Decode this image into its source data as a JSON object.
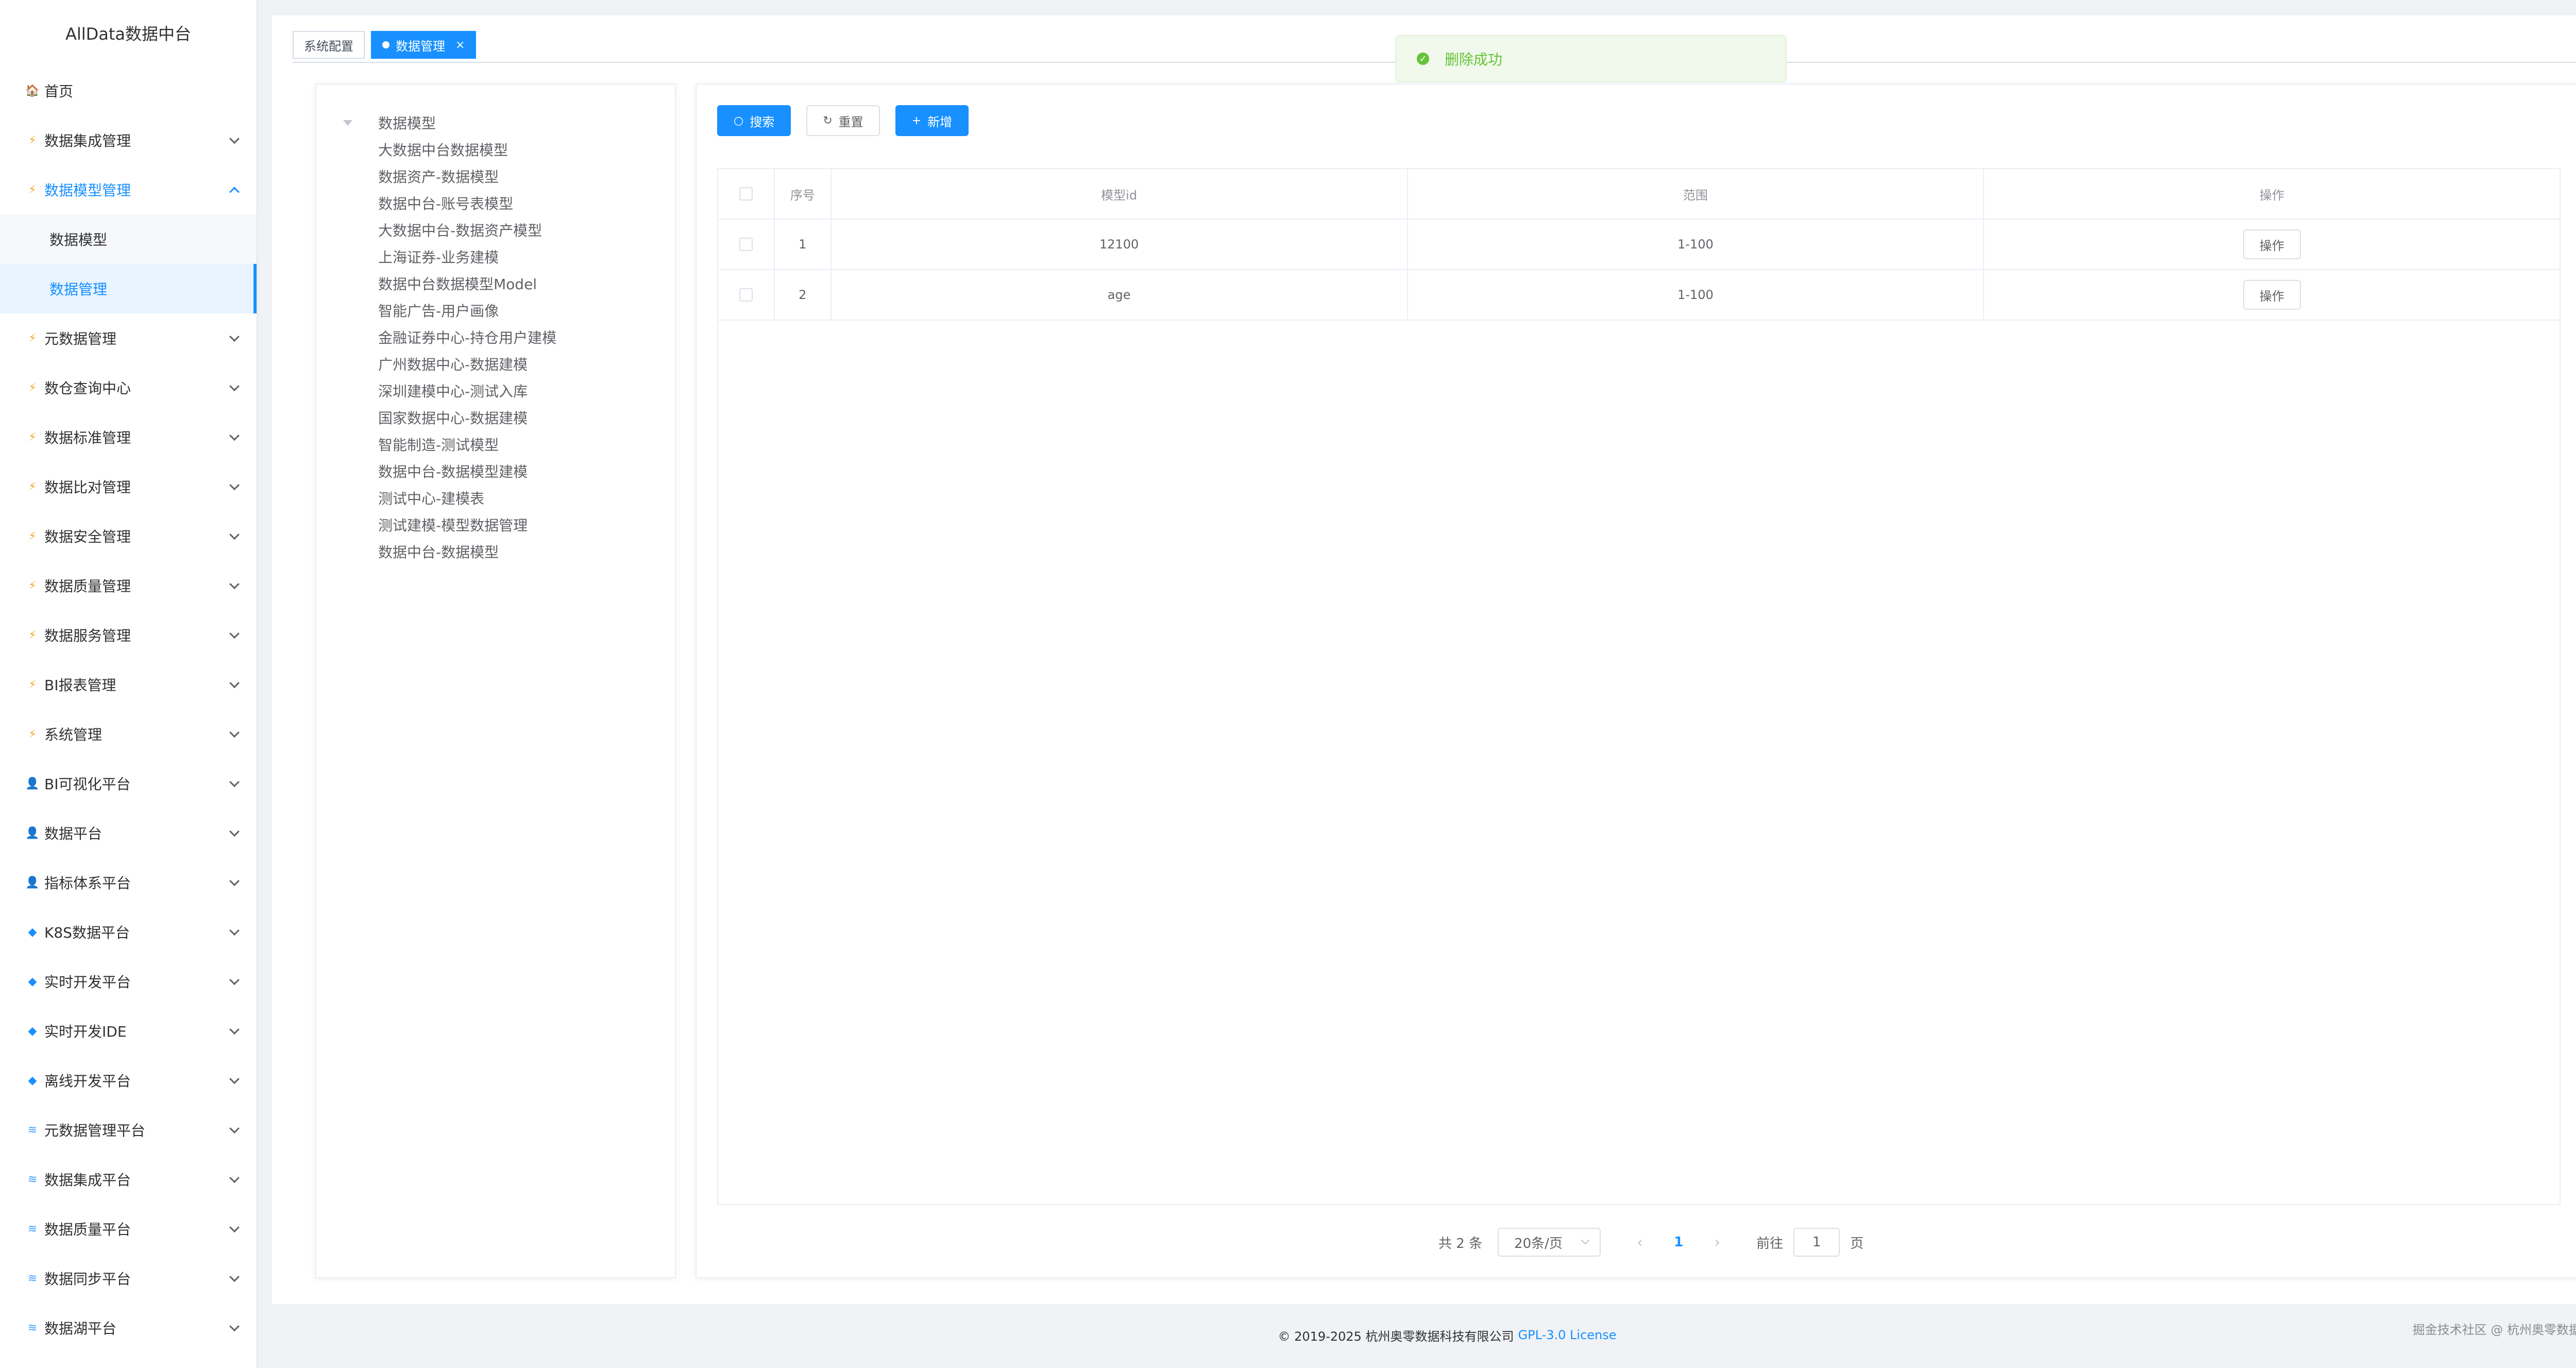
{
  "brand": "AllData数据中台",
  "sidebar": {
    "items": [
      {
        "icon": "🏠",
        "icon_name": "home-icon",
        "label": "首页"
      },
      {
        "icon": "⚡",
        "icon_name": "bolt-icon",
        "label": "数据集成管理"
      },
      {
        "icon": "⚡",
        "icon_name": "bolt-icon",
        "label": "数据模型管理"
      },
      {
        "icon": "⚡",
        "icon_name": "bolt-icon",
        "label": "元数据管理"
      },
      {
        "icon": "⚡",
        "icon_name": "bolt-icon",
        "label": "数仓查询中心"
      },
      {
        "icon": "⚡",
        "icon_name": "bolt-icon",
        "label": "数据标准管理"
      },
      {
        "icon": "⚡",
        "icon_name": "bolt-icon",
        "label": "数据比对管理"
      },
      {
        "icon": "⚡",
        "icon_name": "bolt-icon",
        "label": "数据安全管理"
      },
      {
        "icon": "⚡",
        "icon_name": "bolt-icon",
        "label": "数据质量管理"
      },
      {
        "icon": "⚡",
        "icon_name": "bolt-icon",
        "label": "数据服务管理"
      },
      {
        "icon": "⚡",
        "icon_name": "bolt-icon",
        "label": "BI报表管理"
      },
      {
        "icon": "⚡",
        "icon_name": "bolt-icon",
        "label": "系统管理"
      },
      {
        "icon": "👤",
        "icon_name": "person-icon",
        "label": "BI可视化平台"
      },
      {
        "icon": "👤",
        "icon_name": "person-icon",
        "label": "数据平台"
      },
      {
        "icon": "👤",
        "icon_name": "person-icon",
        "label": "指标体系平台"
      },
      {
        "icon": "◆",
        "icon_name": "gem-icon",
        "label": "K8S数据平台"
      },
      {
        "icon": "◆",
        "icon_name": "gem-icon",
        "label": "实时开发平台"
      },
      {
        "icon": "◆",
        "icon_name": "gem-icon",
        "label": "实时开发IDE"
      },
      {
        "icon": "◆",
        "icon_name": "gem-icon",
        "label": "离线开发平台"
      },
      {
        "icon": "≋",
        "icon_name": "stack-icon",
        "label": "元数据管理平台"
      },
      {
        "icon": "≋",
        "icon_name": "stack-icon",
        "label": "数据集成平台"
      },
      {
        "icon": "≋",
        "icon_name": "stack-icon",
        "label": "数据质量平台"
      },
      {
        "icon": "≋",
        "icon_name": "stack-icon",
        "label": "数据同步平台"
      },
      {
        "icon": "≋",
        "icon_name": "stack-icon",
        "label": "数据湖平台"
      }
    ],
    "sub_items": [
      {
        "label": "数据模型"
      },
      {
        "label": "数据管理"
      }
    ]
  },
  "tags": {
    "first": "系统配置",
    "active": "数据管理",
    "close_glyph": "×"
  },
  "toast": {
    "icon": "✓",
    "text": "删除成功"
  },
  "tree": {
    "root": "数据模型",
    "children": [
      "大数据中台数据模型",
      "数据资产-数据模型",
      "数据中台-账号表模型",
      "大数据中台-数据资产模型",
      "上海证券-业务建模",
      "数据中台数据模型Model",
      "智能广告-用户画像",
      "金融证券中心-持仓用户建模",
      "广州数据中心-数据建模",
      "深圳建模中心-测试入库",
      "国家数据中心-数据建模",
      "智能制造-测试模型",
      "数据中台-数据模型建模",
      "测试中心-建模表",
      "测试建模-模型数据管理",
      "数据中台-数据模型"
    ]
  },
  "toolbar": {
    "search_icon": "○",
    "search": "搜索",
    "reset_icon": "↻",
    "reset": "重置",
    "add_icon": "+",
    "add": "新增"
  },
  "table": {
    "headers": {
      "index": "序号",
      "model_id": "模型id",
      "range": "范围",
      "op": "操作"
    },
    "rows": [
      {
        "index": "1",
        "model_id": "12100",
        "range": "1-100",
        "op": "操作"
      },
      {
        "index": "2",
        "model_id": "age",
        "range": "1-100",
        "op": "操作"
      }
    ]
  },
  "pager": {
    "total": "共 2 条",
    "page_size": "20条/页",
    "prev": "‹",
    "current": "1",
    "next": "›",
    "goto_label": "前往",
    "goto_value": "1",
    "page_suffix": "页"
  },
  "footer": {
    "copyright": "© 2019-2025 杭州奥零数据科技有限公司",
    "license": "GPL-3.0 License"
  },
  "watermark": "掘金技术社区 @ 杭州奥零数据科技",
  "colors": {
    "accent": "#1890ff",
    "success": "#67c23a",
    "toast_bg": "#f0f9eb"
  }
}
